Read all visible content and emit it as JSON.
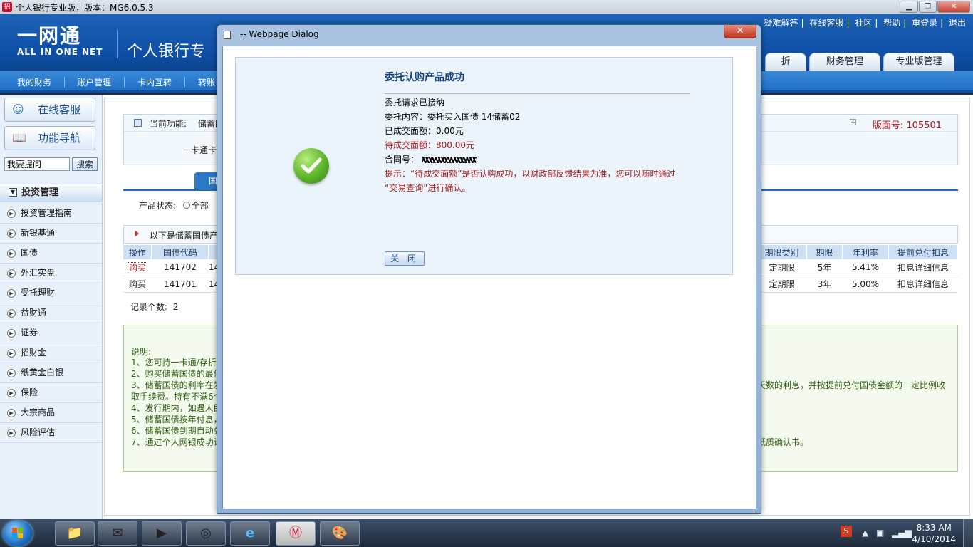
{
  "app": {
    "title": "个人银行专业版，版本：MG6.0.5.3",
    "minimize": "▁",
    "maximize": "❐",
    "close": "✕"
  },
  "header": {
    "logo_big": "一网通",
    "logo_small": "ALL IN ONE NET",
    "product": "个人银行专",
    "top_links": [
      "疑难解答",
      "在线客服",
      "社区",
      "帮助",
      "重登录",
      "退出"
    ],
    "main_tabs": [
      "折",
      "财务管理",
      "专业版管理"
    ]
  },
  "menubar": [
    "我的财务",
    "账户管理",
    "卡内互转",
    "转账"
  ],
  "sidebar": {
    "online_service": "在线客服",
    "func_nav": "功能导航",
    "ask_value": "我要提问",
    "search": "搜索",
    "section": "投资管理",
    "items": [
      "投资管理指南",
      "新银基通",
      "国债",
      "外汇实盘",
      "受托理财",
      "益财通",
      "证券",
      "招财金",
      "纸黄金白银",
      "保险",
      "大宗商品",
      "风险评估"
    ]
  },
  "main": {
    "cur_func_label": "当前功能:",
    "cur_func_value": "储蓄国",
    "version_label": "版面号:",
    "version_value": "105501",
    "line2": "一卡通卡",
    "tab": "国",
    "status_label": "产品状态:",
    "status_option": "全部",
    "list_title": "以下是储蓄国债产",
    "table": {
      "headers_left": [
        "操作",
        "国债代码"
      ],
      "headers_right": [
        "期限类别",
        "期限",
        "年利率",
        "提前兑付扣息"
      ],
      "rows": [
        {
          "op": "购买",
          "code": "141702",
          "name": "14",
          "type": "定期限",
          "term": "5年",
          "rate": "5.41%",
          "detail": "扣息详细信息"
        },
        {
          "op": "购买",
          "code": "141701",
          "name": "14",
          "type": "定期限",
          "term": "3年",
          "rate": "5.00%",
          "detail": "扣息详细信息"
        }
      ]
    },
    "record_label": "记录个数:",
    "record_count": "2",
    "notes": {
      "title": "说明:",
      "lines": [
        "1、您可持一卡通/存折",
        "2、购买储蓄国债的最低",
        "3、储蓄国债的利率在发",
        "取手续费。持有不满6个",
        "4、发行期内，如遇人民",
        "5、储蓄国债按年付息，",
        "6、储蓄国债到期自动兑",
        "7、通过个人网银成功认"
      ],
      "right_3": "天数的利息，并按提前兑付国债金额的一定比例收",
      "right_7": "纸质确认书。"
    }
  },
  "dialog": {
    "title": "-- Webpage Dialog",
    "close": "✕",
    "heading": "委托认购产品成功",
    "accepted": "委托请求已接纳",
    "content": "委托内容：委托买入国债 14储蓄02",
    "done_amount": "已成交面额：0.00元",
    "pending_amount": "待成交面额：800.00元",
    "contract_label": "合同号：",
    "hint_1": "提示：“待成交面额”是否认购成功，以财政部反馈结果为准，您可以随时通过",
    "hint_2": "“交易查询”进行确认。",
    "close_button": "关 闭"
  },
  "taskbar": {
    "time": "8:33 AM",
    "date": "4/10/2014"
  }
}
